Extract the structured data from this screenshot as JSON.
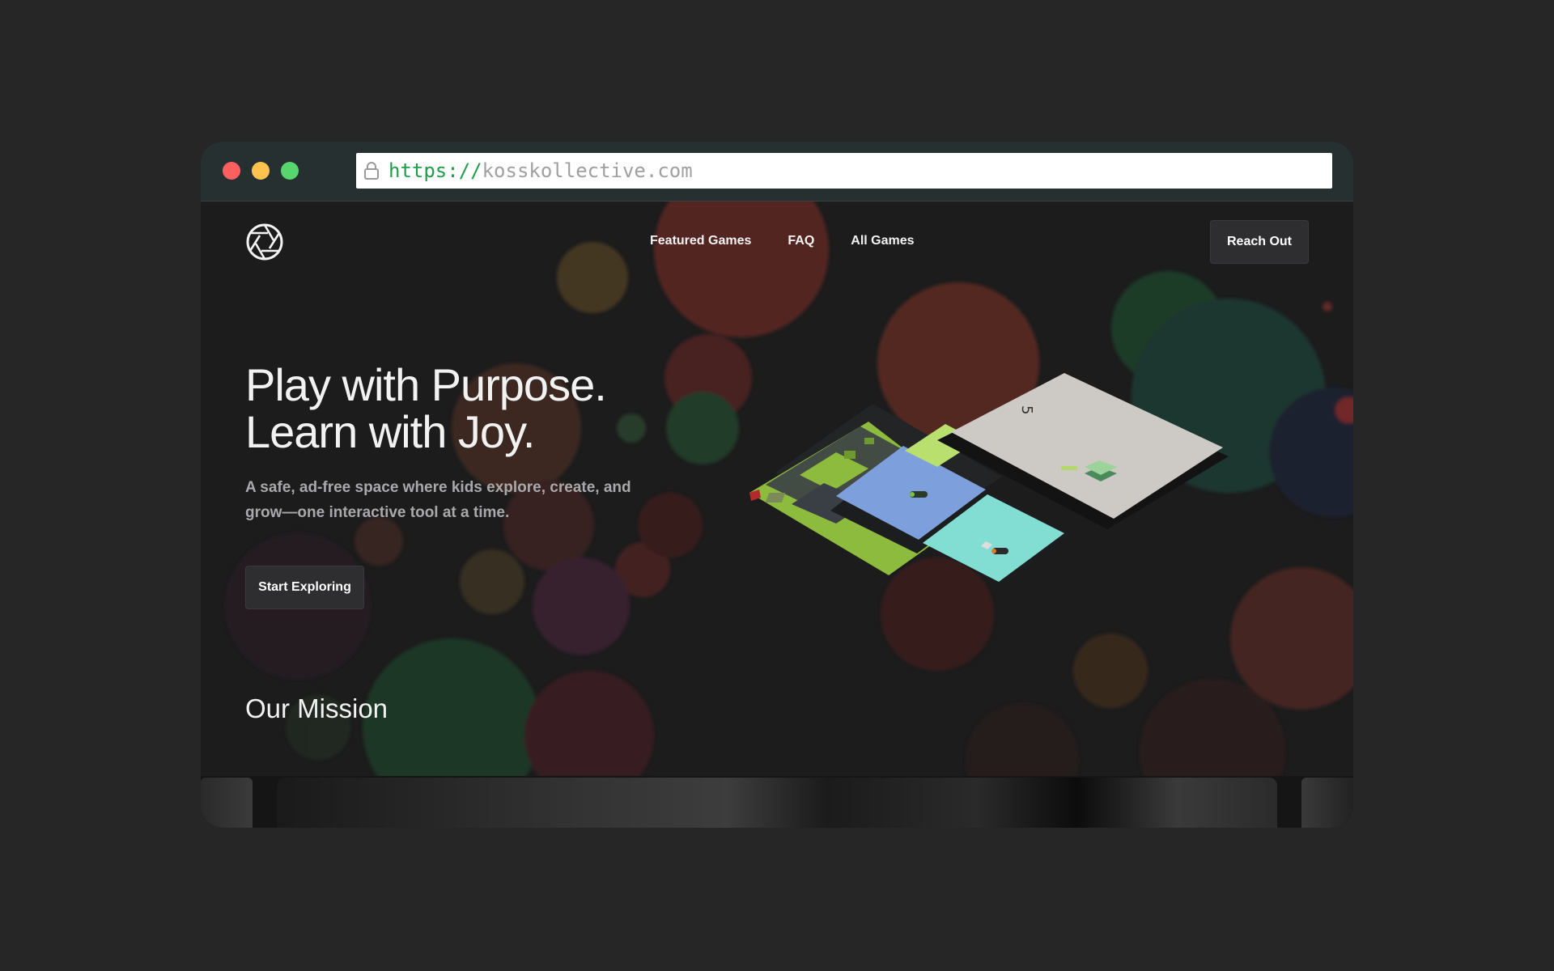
{
  "browser": {
    "url_protocol": "https://",
    "url_host": "kosskollective.com"
  },
  "nav": {
    "links": [
      "Featured Games",
      "FAQ",
      "All Games"
    ],
    "cta_label": "Reach Out"
  },
  "hero": {
    "title_line1": "Play with Purpose.",
    "title_line2": "Learn with Joy.",
    "subtitle": "A safe, ad-free space where kids explore, create, and grow—one interactive tool at a time.",
    "cta_label": "Start Exploring",
    "game_score": "5"
  },
  "mission": {
    "heading": "Our Mission"
  },
  "colors": {
    "page_bg": "#262626",
    "titlebar_bg": "#263031",
    "content_bg": "#1c1c1d",
    "url_protocol": "#1f9e4a",
    "button_bg": "#2e2e30"
  }
}
